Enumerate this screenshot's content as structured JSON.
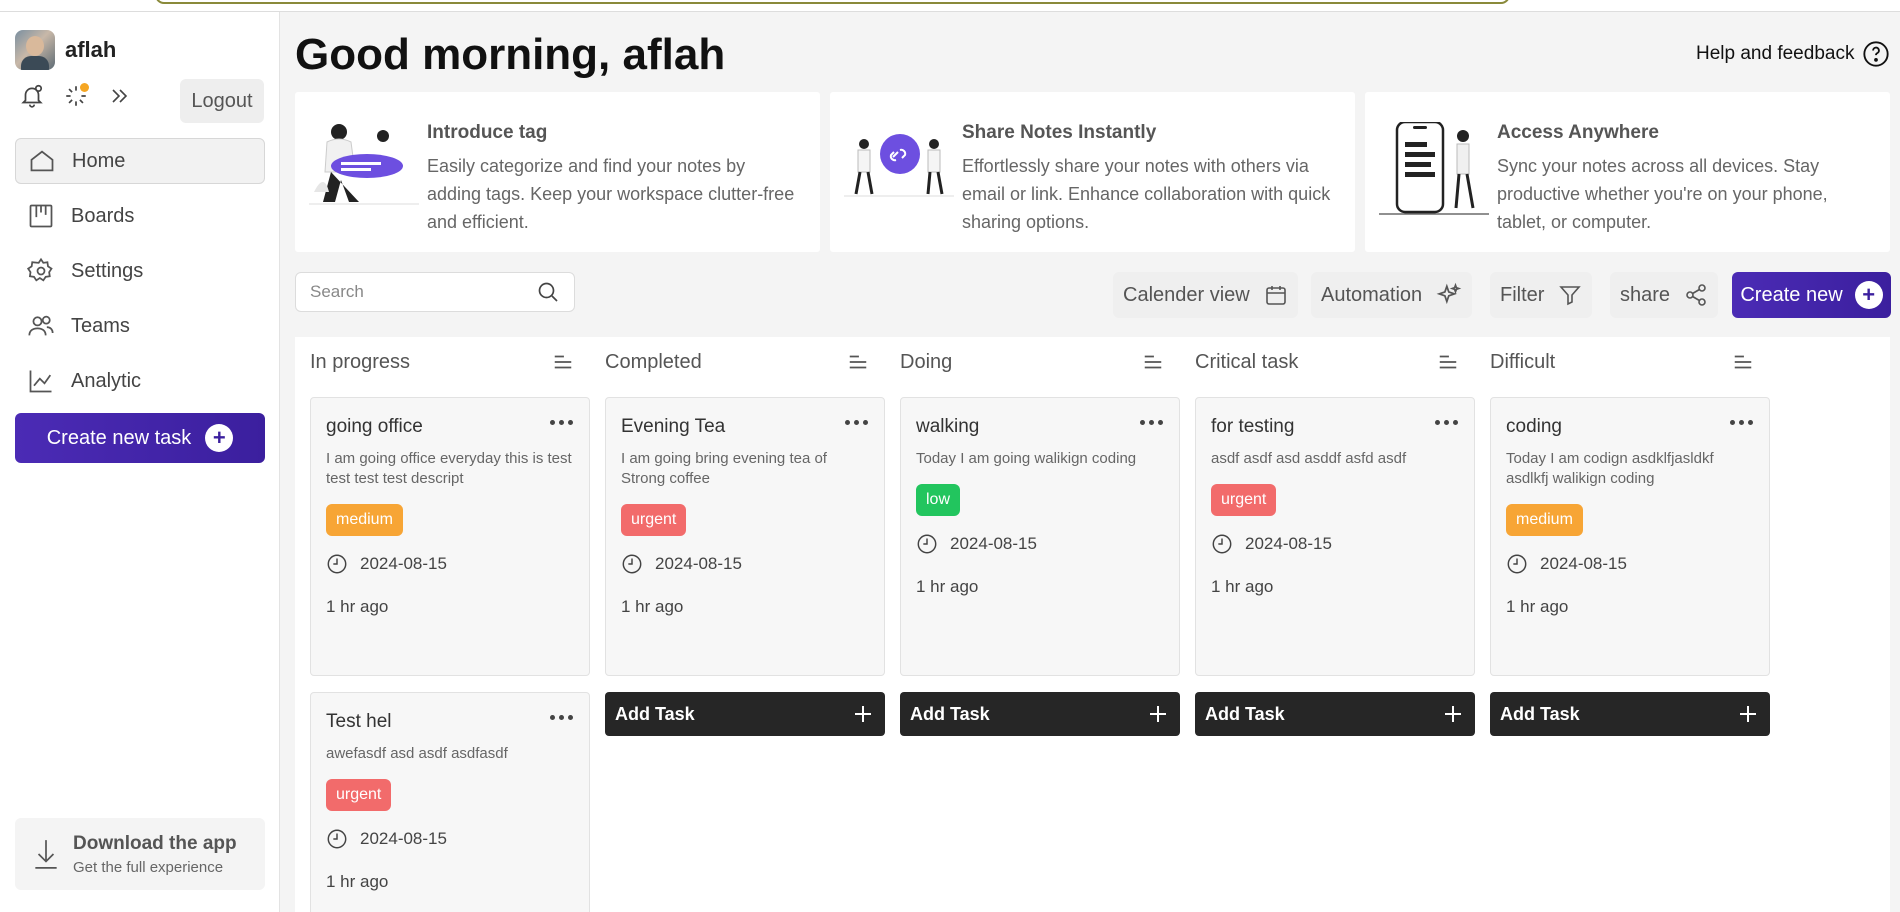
{
  "user": {
    "name": "aflah"
  },
  "sidebar": {
    "logout_label": "Logout",
    "nav": [
      {
        "label": "Home",
        "icon": "home-icon",
        "active": true
      },
      {
        "label": "Boards",
        "icon": "boards-icon"
      },
      {
        "label": "Settings",
        "icon": "gear-icon"
      },
      {
        "label": "Teams",
        "icon": "users-icon"
      },
      {
        "label": "Analytic",
        "icon": "chart-icon"
      }
    ],
    "create_task_label": "Create new task",
    "download": {
      "title": "Download the app",
      "subtitle": "Get the full experience"
    }
  },
  "header": {
    "greeting": "Good morning, aflah",
    "help_label": "Help and feedback"
  },
  "promos": [
    {
      "title": "Introduce tag",
      "desc": "Easily categorize and find your notes by adding tags. Keep your workspace clutter-free and efficient."
    },
    {
      "title": "Share Notes Instantly",
      "desc": "Effortlessly share your notes with others via email or link. Enhance collaboration with quick sharing options."
    },
    {
      "title": "Access Anywhere",
      "desc": "Sync your notes across all devices. Stay productive whether you're on your phone, tablet, or computer."
    }
  ],
  "toolbar": {
    "search_placeholder": "Search",
    "calendar_label": "Calender view",
    "automation_label": "Automation",
    "filter_label": "Filter",
    "share_label": "share",
    "create_new_label": "Create new"
  },
  "add_task_label": "Add Task",
  "columns": [
    {
      "title": "In progress",
      "cards": [
        {
          "title": "going office",
          "desc": "I am going office everyday this is test test test test descript",
          "priority": "medium",
          "date": "2024-08-15",
          "ago": "1 hr ago"
        },
        {
          "title": "Test hel",
          "desc": "awefasdf asd asdf asdfasdf",
          "priority": "urgent",
          "date": "2024-08-15",
          "ago": "1 hr ago"
        }
      ]
    },
    {
      "title": "Completed",
      "cards": [
        {
          "title": "Evening Tea",
          "desc": "I am going bring evening tea of Strong coffee",
          "priority": "urgent",
          "date": "2024-08-15",
          "ago": "1 hr ago"
        }
      ]
    },
    {
      "title": "Doing",
      "cards": [
        {
          "title": "walking",
          "desc": "Today I am going walikign coding",
          "priority": "low",
          "date": "2024-08-15",
          "ago": "1 hr ago"
        }
      ]
    },
    {
      "title": "Critical task",
      "cards": [
        {
          "title": "for testing",
          "desc": "asdf asdf asd asddf asfd asdf",
          "priority": "urgent",
          "date": "2024-08-15",
          "ago": "1 hr ago"
        }
      ]
    },
    {
      "title": "Difficult",
      "cards": [
        {
          "title": "coding",
          "desc": "Today I am codign asdklfjasldkf asdlkfj walikign coding",
          "priority": "medium",
          "date": "2024-08-15",
          "ago": "1 hr ago"
        }
      ]
    }
  ],
  "colors": {
    "accent": "#3b1f9e",
    "medium": "#f7a535",
    "urgent": "#f26b6b",
    "low": "#22c55e"
  }
}
